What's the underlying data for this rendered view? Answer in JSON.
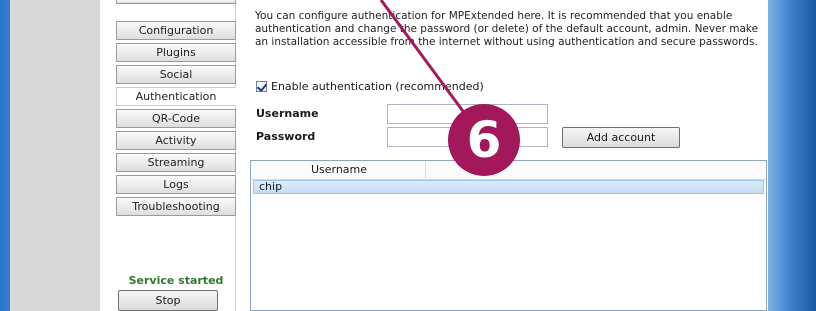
{
  "sidebar": {
    "items": [
      {
        "label": "Configuration"
      },
      {
        "label": "Plugins"
      },
      {
        "label": "Social"
      },
      {
        "label": "Authentication"
      },
      {
        "label": "QR-Code"
      },
      {
        "label": "Activity"
      },
      {
        "label": "Streaming"
      },
      {
        "label": "Logs"
      },
      {
        "label": "Troubleshooting"
      }
    ],
    "active_item": "Authentication",
    "service_status": "Service started",
    "stop_label": "Stop"
  },
  "main": {
    "description": "You can configure authentication for MPExtended here. It is recommended that you enable authentication and change the password (or delete) of the default account, admin. Never make an installation accessible from the internet without using authentication and secure passwords.",
    "enable_label": "Enable authentication (recommended)",
    "enable_checked": true,
    "username_label": "Username",
    "username_value": "",
    "password_label": "Password",
    "password_value": "",
    "add_account_label": "Add account",
    "users_list": {
      "column_header": "Username",
      "rows": [
        "chip"
      ]
    }
  },
  "callout": {
    "number": "6",
    "color": "#a3185a"
  }
}
